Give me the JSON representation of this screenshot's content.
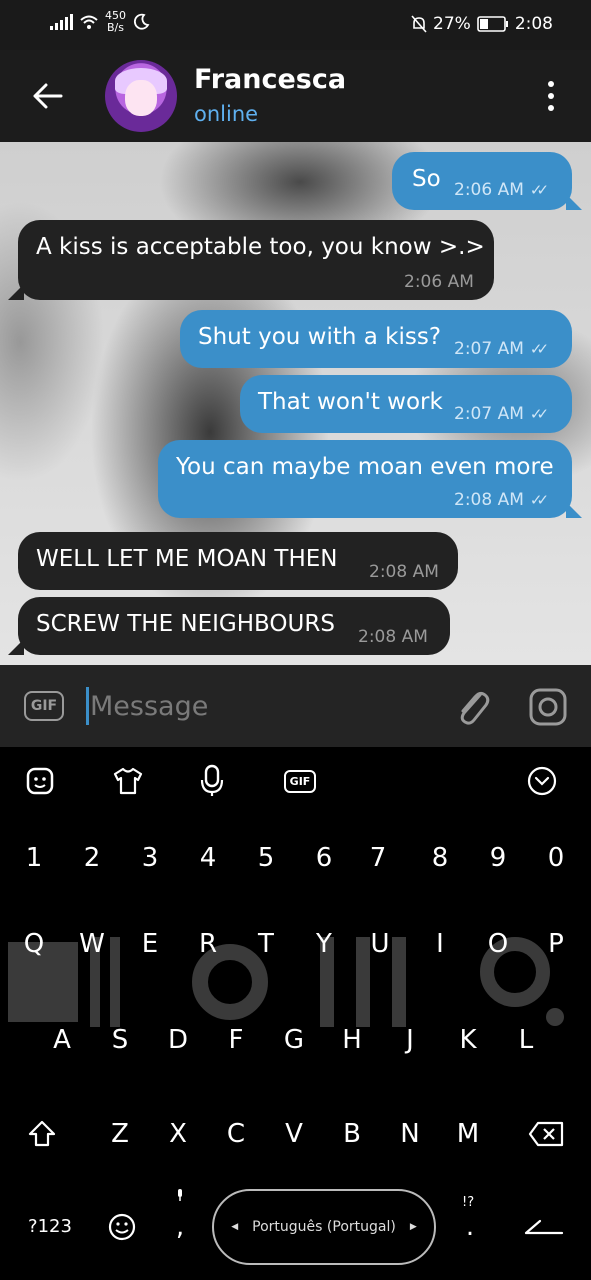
{
  "status_bar": {
    "net_speed_value": "450",
    "net_speed_unit": "B/s",
    "battery": "27%",
    "time": "2:08",
    "icons": [
      "signal-icon",
      "wifi-icon",
      "moon-icon",
      "mute-bell-icon",
      "battery-icon"
    ]
  },
  "header": {
    "contact_name": "Francesca",
    "status": "online",
    "icons": [
      "back-arrow-icon",
      "avatar",
      "more-vertical-icon"
    ]
  },
  "messages": [
    {
      "dir": "out",
      "text": "So",
      "time": "2:06 AM",
      "read": true
    },
    {
      "dir": "in",
      "text": "A kiss is acceptable too, you know >.>",
      "time": "2:06 AM"
    },
    {
      "dir": "out",
      "text": "Shut you with a kiss?",
      "time": "2:07 AM",
      "read": true
    },
    {
      "dir": "out",
      "text": "That won't work",
      "time": "2:07 AM",
      "read": true
    },
    {
      "dir": "out",
      "text": "You can maybe moan even more",
      "time": "2:08 AM",
      "read": true
    },
    {
      "dir": "in",
      "text": "WELL LET ME MOAN THEN",
      "time": "2:08 AM"
    },
    {
      "dir": "in",
      "text": "SCREW THE NEIGHBOURS",
      "time": "2:08 AM"
    }
  ],
  "composer": {
    "gif_label": "GIF",
    "placeholder": "Message",
    "icons": [
      "attach-icon",
      "camera-icon"
    ]
  },
  "keyboard": {
    "toolbar_gif_label": "GIF",
    "toolbar_icons": [
      "emoji-sticker-icon",
      "tshirt-icon",
      "microphone-icon",
      "gif-icon",
      "collapse-chevron-icon"
    ],
    "number_row": [
      "1",
      "2",
      "3",
      "4",
      "5",
      "6",
      "7",
      "8",
      "9",
      "0"
    ],
    "row1": [
      "Q",
      "W",
      "E",
      "R",
      "T",
      "Y",
      "U",
      "I",
      "O",
      "P"
    ],
    "row2": [
      "A",
      "S",
      "D",
      "F",
      "G",
      "H",
      "J",
      "K",
      "L"
    ],
    "row3": [
      "Z",
      "X",
      "C",
      "V",
      "B",
      "N",
      "M"
    ],
    "symbols_key": "?123",
    "comma_key": ",",
    "period_key": ".",
    "punct_hint": "!?",
    "space_label": "Português (Portugal)",
    "colors": {
      "accent": "#3b8fc9",
      "bubble_out": "#3b8fc9",
      "bubble_in": "#222222"
    }
  }
}
